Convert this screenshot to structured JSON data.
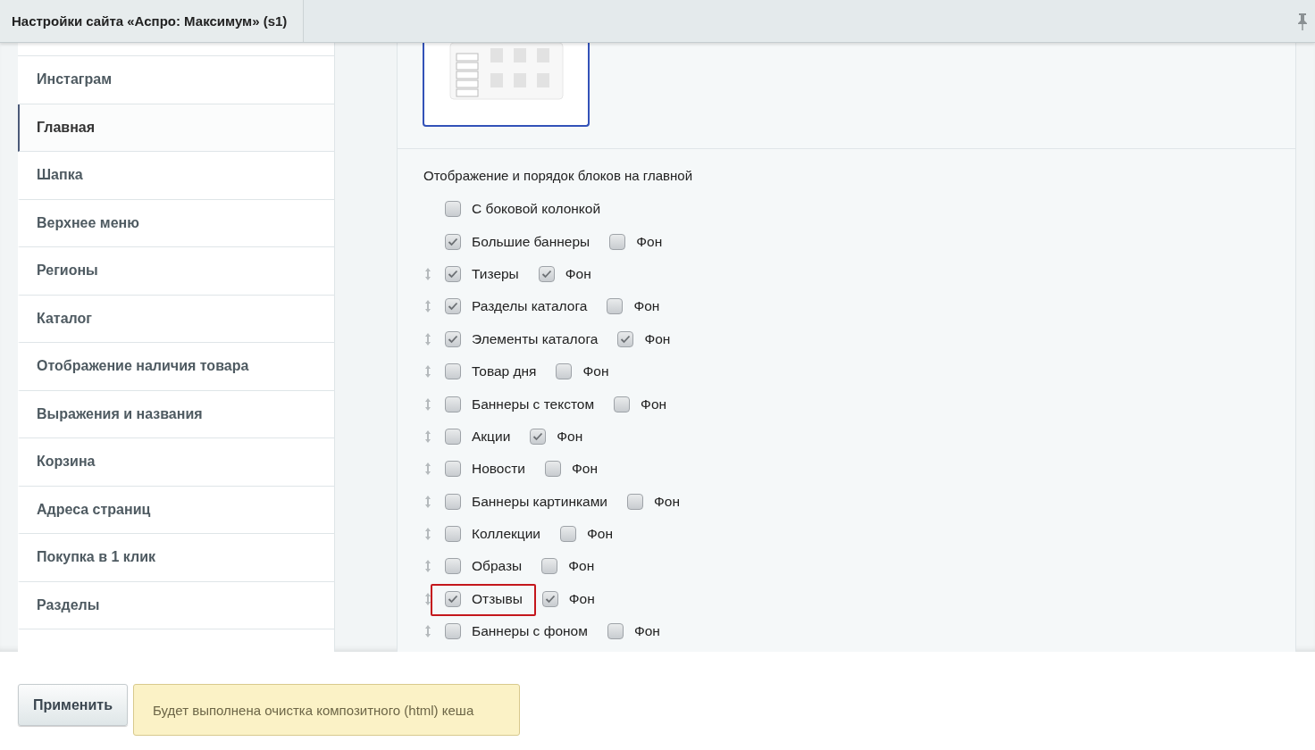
{
  "window": {
    "tab_title": "Настройки сайта «Аспро: Максимум» (s1)"
  },
  "sidebar": {
    "items": [
      {
        "label": "Инстаграм",
        "selected": false
      },
      {
        "label": "Главная",
        "selected": true
      },
      {
        "label": "Шапка",
        "selected": false
      },
      {
        "label": "Верхнее меню",
        "selected": false
      },
      {
        "label": "Регионы",
        "selected": false
      },
      {
        "label": "Каталог",
        "selected": false
      },
      {
        "label": "Отображение наличия товара",
        "selected": false
      },
      {
        "label": "Выражения и названия",
        "selected": false
      },
      {
        "label": "Корзина",
        "selected": false
      },
      {
        "label": "Адреса страниц",
        "selected": false
      },
      {
        "label": "Покупка в 1 клик",
        "selected": false
      },
      {
        "label": "Разделы",
        "selected": false
      }
    ]
  },
  "blocks": {
    "title": "Отображение и порядок блоков на главной",
    "rows": [
      {
        "label": "С боковой колонкой",
        "checked": false,
        "draggable": false,
        "highlighted": false
      },
      {
        "label": "Большие баннеры",
        "checked": true,
        "draggable": false,
        "highlighted": false,
        "background": {
          "label": "Фон",
          "checked": false
        }
      },
      {
        "label": "Тизеры",
        "checked": true,
        "draggable": true,
        "highlighted": false,
        "background": {
          "label": "Фон",
          "checked": true
        }
      },
      {
        "label": "Разделы каталога",
        "checked": true,
        "draggable": true,
        "highlighted": false,
        "background": {
          "label": "Фон",
          "checked": false
        }
      },
      {
        "label": "Элементы каталога",
        "checked": true,
        "draggable": true,
        "highlighted": false,
        "background": {
          "label": "Фон",
          "checked": true
        }
      },
      {
        "label": "Товар дня",
        "checked": false,
        "draggable": true,
        "highlighted": false,
        "background": {
          "label": "Фон",
          "checked": false
        }
      },
      {
        "label": "Баннеры с текстом",
        "checked": false,
        "draggable": true,
        "highlighted": false,
        "background": {
          "label": "Фон",
          "checked": false
        }
      },
      {
        "label": "Акции",
        "checked": false,
        "draggable": true,
        "highlighted": false,
        "background": {
          "label": "Фон",
          "checked": true
        }
      },
      {
        "label": "Новости",
        "checked": false,
        "draggable": true,
        "highlighted": false,
        "background": {
          "label": "Фон",
          "checked": false
        }
      },
      {
        "label": "Баннеры картинками",
        "checked": false,
        "draggable": true,
        "highlighted": false,
        "background": {
          "label": "Фон",
          "checked": false
        }
      },
      {
        "label": "Коллекции",
        "checked": false,
        "draggable": true,
        "highlighted": false,
        "background": {
          "label": "Фон",
          "checked": false
        }
      },
      {
        "label": "Образы",
        "checked": false,
        "draggable": true,
        "highlighted": false,
        "background": {
          "label": "Фон",
          "checked": false
        }
      },
      {
        "label": "Отзывы",
        "checked": true,
        "draggable": true,
        "highlighted": true,
        "background": {
          "label": "Фон",
          "checked": true
        }
      },
      {
        "label": "Баннеры с фоном",
        "checked": false,
        "draggable": true,
        "highlighted": false,
        "background": {
          "label": "Фон",
          "checked": false
        }
      }
    ]
  },
  "footer": {
    "apply_button": "Применить",
    "notice": "Будет выполнена очистка композитного (html) кеша"
  }
}
